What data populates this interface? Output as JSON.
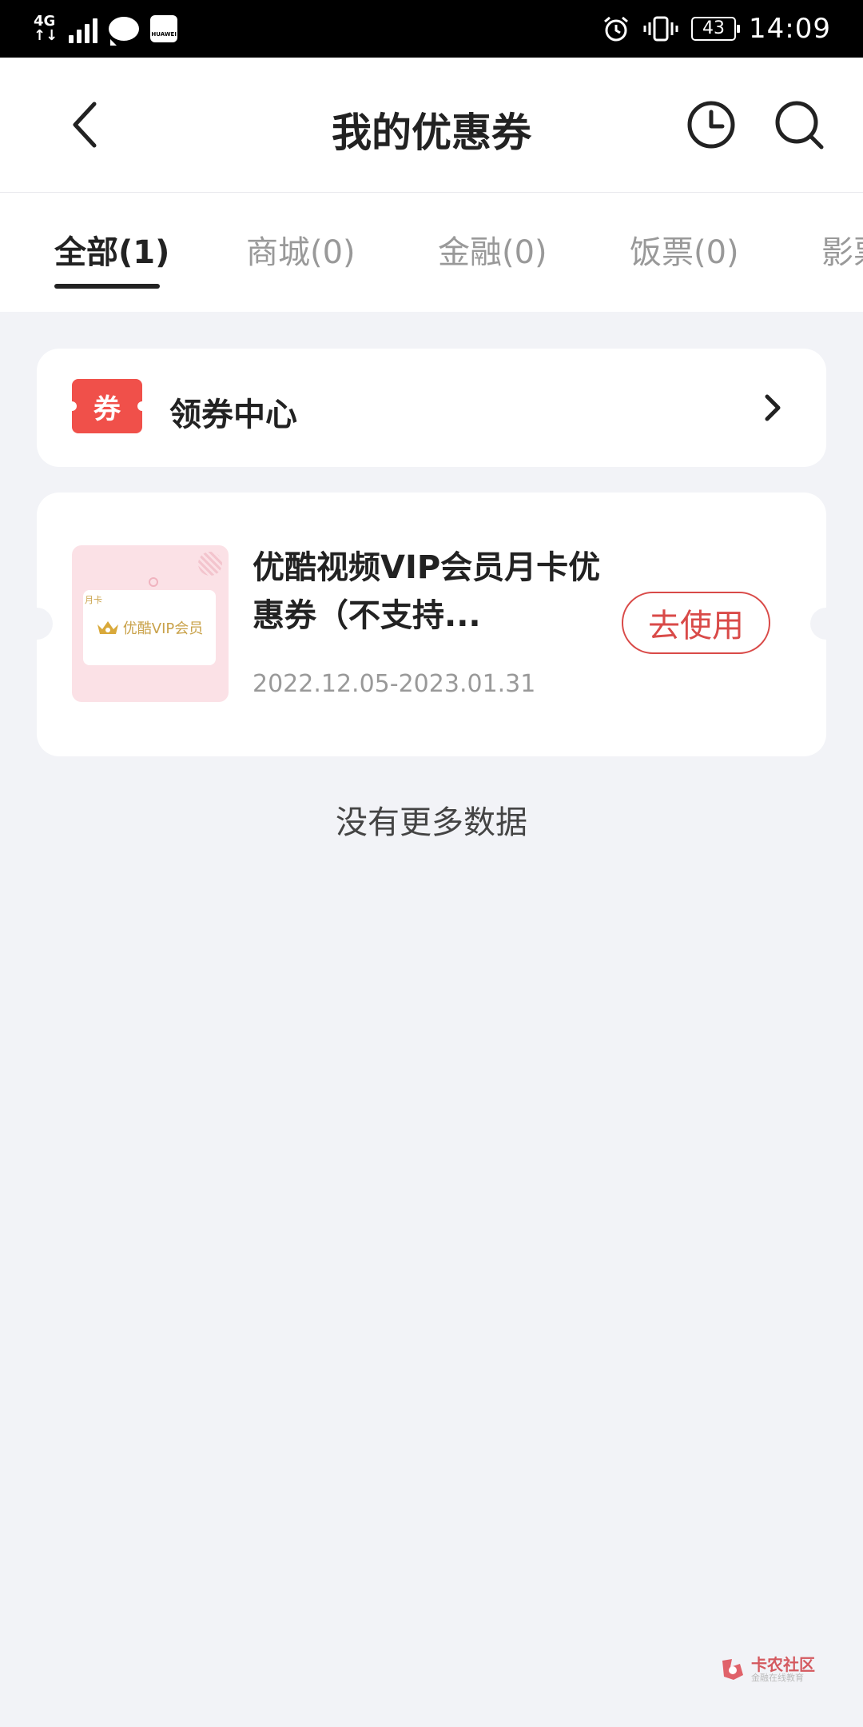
{
  "status_bar": {
    "network_top": "4G",
    "network_bottom": "↑↓",
    "huawei_label": "HUAWEI",
    "battery": "43",
    "time": "14:09"
  },
  "header": {
    "title": "我的优惠券"
  },
  "tabs": [
    {
      "label": "全部(1)",
      "active": true
    },
    {
      "label": "商城(0)",
      "active": false
    },
    {
      "label": "金融(0)",
      "active": false
    },
    {
      "label": "饭票(0)",
      "active": false
    },
    {
      "label": "影票",
      "active": false
    }
  ],
  "coupon_center": {
    "badge": "券",
    "label": "领券中心"
  },
  "coupons": [
    {
      "thumb_tag": "月卡",
      "thumb_brand": "优酷VIP会员",
      "name": "优酷视频VIP会员月卡优惠券（不支持...",
      "date_range": "2022.12.05-2023.01.31",
      "action_label": "去使用"
    }
  ],
  "footer": {
    "no_more": "没有更多数据"
  },
  "watermark": {
    "main": "卡农社区",
    "sub": "金融在线教育"
  },
  "colors": {
    "accent": "#d94a48",
    "badge": "#f0504a",
    "background": "#f2f3f7"
  }
}
